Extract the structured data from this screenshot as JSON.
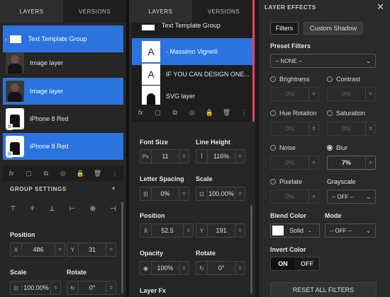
{
  "p1": {
    "tabs": [
      "LAYERS",
      "VERSIONS"
    ],
    "layers": [
      "Text Template Group",
      "Image layer",
      "Image layer",
      "iPhone 8 Red",
      "iPhone 8 Red"
    ],
    "toolbar": [
      "fx",
      "▢",
      "⧉",
      "◎",
      "🔒",
      "🗑",
      "⋮"
    ],
    "group_settings": "GROUP SETTINGS",
    "position_label": "Position",
    "pos_x_prefix": "X",
    "pos_x": "486",
    "pos_y_prefix": "Y",
    "pos_y": "31",
    "scale_label": "Scale",
    "scale": "100.00%",
    "rotate_label": "Rotate",
    "rotate": "0°"
  },
  "p2": {
    "tabs": [
      "LAYERS",
      "VERSIONS"
    ],
    "layers": [
      "Text Template Group",
      "- Massimo Vignelli",
      "IF YOU CAN DESIGN ONE...",
      "SVG layer"
    ],
    "toolbar": [
      "fx",
      "▢",
      "⧉",
      "◎",
      "🔒",
      "🗑",
      "⋮"
    ],
    "font_size_label": "Font Size",
    "font_size_prefix": "Px",
    "font_size": "11",
    "line_height_label": "Line Height",
    "line_height": "116%",
    "letter_spacing_label": "Letter Spacing",
    "letter_spacing": "0%",
    "scale_label": "Scale",
    "scale": "100.00%",
    "position_label": "Position",
    "pos_x_prefix": "X",
    "pos_x": "52.5",
    "pos_y_prefix": "Y",
    "pos_y": "191",
    "opacity_label": "Opacity",
    "opacity": "100%",
    "rotate_label": "Rotate",
    "rotate": "0°",
    "layer_fx": "Layer Fx"
  },
  "p3": {
    "title": "LAYER EFFECTS",
    "tab_filters": "Filters",
    "tab_shadow": "Custom Shadow",
    "preset_label": "Preset Filters",
    "preset_value": "-- NONE --",
    "brightness": "Brightness",
    "brightness_val": "0%",
    "contrast": "Contrast",
    "contrast_val": "0%",
    "hue": "Hue Rotation",
    "hue_val": "0%",
    "saturation": "Saturation",
    "saturation_val": "0%",
    "noise": "Noise",
    "noise_val": "0%",
    "blur": "Blur",
    "blur_val": "7%",
    "pixelate": "Pixelate",
    "pixelate_val": "0%",
    "grayscale": "Grayscale",
    "grayscale_val": "-- OFF --",
    "blend_color_label": "Blend Color",
    "blend_color_mode": "Solid",
    "mode_label": "Mode",
    "mode_val": "-- OFF --",
    "invert_label": "Invert Color",
    "invert_on": "ON",
    "invert_off": "OFF",
    "reset": "RESET ALL FILTERS"
  },
  "colors": {
    "accent": "#2b74e0",
    "panel": "#262626",
    "background": "#1a1a1a"
  }
}
